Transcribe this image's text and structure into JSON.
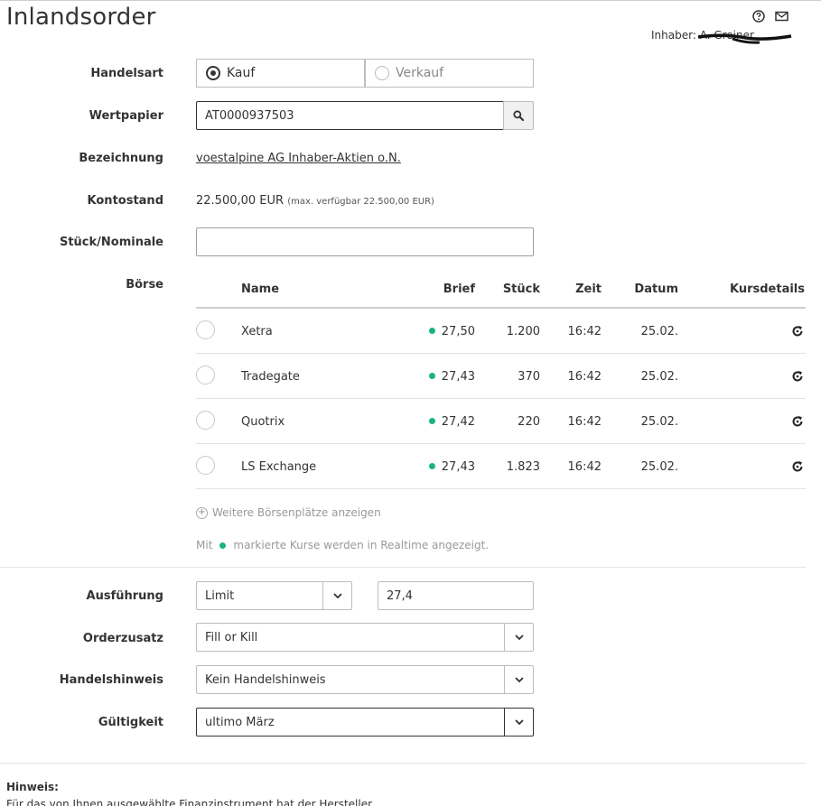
{
  "header": {
    "title": "Inlandsorder",
    "owner_label": "Inhaber:",
    "owner_name": "A. Greiner",
    "icons": [
      "help-icon",
      "mail-icon"
    ]
  },
  "form": {
    "handelsart": {
      "label": "Handelsart",
      "options": [
        {
          "label": "Kauf",
          "selected": true
        },
        {
          "label": "Verkauf",
          "selected": false
        }
      ]
    },
    "wertpapier": {
      "label": "Wertpapier",
      "value": "AT0000937503"
    },
    "bezeichnung": {
      "label": "Bezeichnung",
      "value": "voestalpine AG Inhaber-Aktien o.N."
    },
    "kontostand": {
      "label": "Kontostand",
      "value": "22.500,00 EUR",
      "available": "(max. verfügbar 22.500,00 EUR)"
    },
    "stueck": {
      "label": "Stück/Nominale",
      "value": ""
    },
    "boerse": {
      "label": "Börse",
      "columns": {
        "name": "Name",
        "brief": "Brief",
        "stueck": "Stück",
        "zeit": "Zeit",
        "datum": "Datum",
        "kursdetails": "Kursdetails"
      },
      "rows": [
        {
          "name": "Xetra",
          "brief": "27,50",
          "stueck": "1.200",
          "zeit": "16:42",
          "datum": "25.02."
        },
        {
          "name": "Tradegate",
          "brief": "27,43",
          "stueck": "370",
          "zeit": "16:42",
          "datum": "25.02."
        },
        {
          "name": "Quotrix",
          "brief": "27,42",
          "stueck": "220",
          "zeit": "16:42",
          "datum": "25.02."
        },
        {
          "name": "LS Exchange",
          "brief": "27,43",
          "stueck": "1.823",
          "zeit": "16:42",
          "datum": "25.02."
        }
      ],
      "more_link": "Weitere Börsenplätze anzeigen",
      "realtime_note_prefix": "Mit",
      "realtime_note_suffix": "markierte Kurse werden in Realtime angezeigt.",
      "realtime_color": "#1ab37d"
    },
    "ausfuehrung": {
      "label": "Ausführung",
      "value": "Limit",
      "limit": "27,4"
    },
    "orderzusatz": {
      "label": "Orderzusatz",
      "value": "Fill or Kill"
    },
    "handelshinweis": {
      "label": "Handelshinweis",
      "value": "Kein Handelshinweis"
    },
    "gueltigkeit": {
      "label": "Gültigkeit",
      "value": "ultimo März"
    }
  },
  "hinweis": {
    "label": "Hinweis:",
    "text": "Für das von Ihnen ausgewählte Finanzinstrument hat der Hersteller"
  }
}
